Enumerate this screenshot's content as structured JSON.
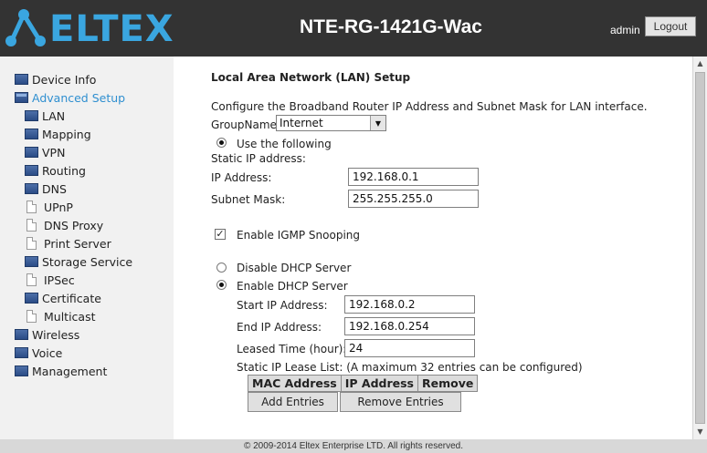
{
  "header": {
    "logo_text": "ELTEX",
    "device_title": "NTE-RG-1421G-Wac",
    "user": "admin",
    "logout_label": "Logout",
    "brand_color": "#3aa6e0"
  },
  "sidebar": {
    "items": [
      {
        "label": "Device Info",
        "icon": "folder-icon"
      },
      {
        "label": "Advanced Setup",
        "icon": "folder-open-icon",
        "active": true
      },
      {
        "label": "LAN",
        "icon": "folder-icon"
      },
      {
        "label": "Mapping",
        "icon": "folder-icon"
      },
      {
        "label": "VPN",
        "icon": "folder-icon"
      },
      {
        "label": "Routing",
        "icon": "folder-icon"
      },
      {
        "label": "DNS",
        "icon": "folder-icon"
      },
      {
        "label": "UPnP",
        "icon": "document-icon"
      },
      {
        "label": "DNS Proxy",
        "icon": "document-icon"
      },
      {
        "label": "Print Server",
        "icon": "document-icon"
      },
      {
        "label": "Storage Service",
        "icon": "folder-icon"
      },
      {
        "label": "IPSec",
        "icon": "document-icon"
      },
      {
        "label": "Certificate",
        "icon": "folder-icon"
      },
      {
        "label": "Multicast",
        "icon": "document-icon"
      },
      {
        "label": "Wireless",
        "icon": "folder-icon"
      },
      {
        "label": "Voice",
        "icon": "folder-icon"
      },
      {
        "label": "Management",
        "icon": "folder-icon"
      }
    ]
  },
  "main": {
    "title": "Local Area Network (LAN) Setup",
    "description": "Configure the Broadband Router IP Address and Subnet Mask for LAN interface.",
    "group_name_label": "GroupName",
    "group_name_value": "Internet",
    "use_following_label": "Use the following",
    "static_ip_label": "Static IP address:",
    "ip_address_label": "IP Address:",
    "ip_address_value": "192.168.0.1",
    "subnet_mask_label": "Subnet Mask:",
    "subnet_mask_value": "255.255.255.0",
    "igmp_label": "Enable IGMP Snooping",
    "igmp_checked": true,
    "disable_dhcp_label": "Disable DHCP Server",
    "enable_dhcp_label": "Enable DHCP Server",
    "start_ip_label": "Start IP Address:",
    "start_ip_value": "192.168.0.2",
    "end_ip_label": "End IP Address:",
    "end_ip_value": "192.168.0.254",
    "lease_time_label": "Leased Time (hour):",
    "lease_time_value": "24",
    "lease_list_label": "Static IP Lease List: (A maximum 32 entries can be configured)",
    "lease_columns": [
      "MAC Address",
      "IP Address",
      "Remove"
    ],
    "add_entries_label": "Add Entries",
    "remove_entries_label": "Remove Entries"
  },
  "footer": {
    "copyright": "© 2009-2014 Eltex Enterprise LTD. All rights reserved."
  }
}
